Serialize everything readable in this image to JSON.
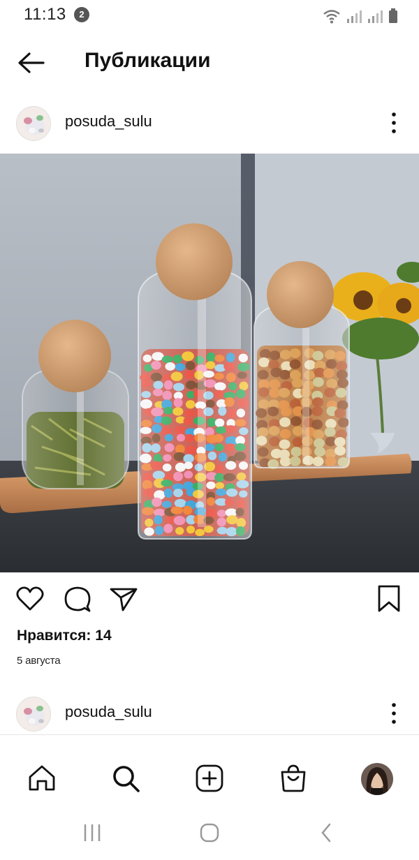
{
  "status_bar": {
    "time": "11:13",
    "notification_count": "2"
  },
  "header": {
    "title": "Публикации"
  },
  "post": {
    "username": "posuda_sulu",
    "likes": "Нравится: 14",
    "date": "5 августа"
  },
  "next_post": {
    "username": "posuda_sulu"
  },
  "icons": {
    "back": "arrow-left-icon",
    "more": "three-dots-vertical-icon",
    "like": "heart-icon",
    "comment": "speech-bubble-icon",
    "share": "paper-plane-icon",
    "save": "bookmark-icon",
    "home": "home-icon",
    "search": "search-icon",
    "create": "plus-square-icon",
    "shop": "shopping-bag-icon"
  }
}
